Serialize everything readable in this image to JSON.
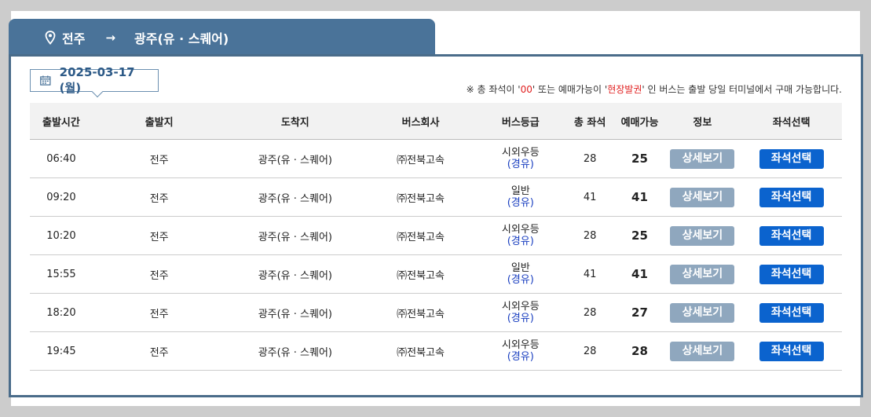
{
  "route": {
    "from": "전주",
    "to": "광주(유 · 스퀘어)",
    "arrow": "→"
  },
  "date": "2025-03-17 (월)",
  "notice": {
    "prefix": "※ 총 좌석이 '",
    "code": "00",
    "middle": "' 또는 예매가능이 '",
    "onsite": "현장발권",
    "suffix": "' 인 버스는 출발 당일 터미널에서 구매 가능합니다."
  },
  "headers": [
    "출발시간",
    "출발지",
    "도착지",
    "버스회사",
    "버스등급",
    "총 좌석",
    "예매가능",
    "정보",
    "좌석선택"
  ],
  "rows": [
    {
      "time": "06:40",
      "from": "전주",
      "to": "광주(유 · 스퀘어)",
      "company": "㈜전북고속",
      "grade": "시외우등",
      "via": "(경유)",
      "total": "28",
      "avail": "25",
      "detail": "상세보기",
      "seat": "좌석선택"
    },
    {
      "time": "09:20",
      "from": "전주",
      "to": "광주(유 · 스퀘어)",
      "company": "㈜전북고속",
      "grade": "일반",
      "via": "(경유)",
      "total": "41",
      "avail": "41",
      "detail": "상세보기",
      "seat": "좌석선택"
    },
    {
      "time": "10:20",
      "from": "전주",
      "to": "광주(유 · 스퀘어)",
      "company": "㈜전북고속",
      "grade": "시외우등",
      "via": "(경유)",
      "total": "28",
      "avail": "25",
      "detail": "상세보기",
      "seat": "좌석선택"
    },
    {
      "time": "15:55",
      "from": "전주",
      "to": "광주(유 · 스퀘어)",
      "company": "㈜전북고속",
      "grade": "일반",
      "via": "(경유)",
      "total": "41",
      "avail": "41",
      "detail": "상세보기",
      "seat": "좌석선택"
    },
    {
      "time": "18:20",
      "from": "전주",
      "to": "광주(유 · 스퀘어)",
      "company": "㈜전북고속",
      "grade": "시외우등",
      "via": "(경유)",
      "total": "28",
      "avail": "27",
      "detail": "상세보기",
      "seat": "좌석선택"
    },
    {
      "time": "19:45",
      "from": "전주",
      "to": "광주(유 · 스퀘어)",
      "company": "㈜전북고속",
      "grade": "시외우등",
      "via": "(경유)",
      "total": "28",
      "avail": "28",
      "detail": "상세보기",
      "seat": "좌석선택"
    }
  ],
  "icons": {
    "route": "location-pin-icon",
    "date": "calendar-icon"
  },
  "colors": {
    "tab": "#4a7399",
    "panel_border": "#4a6c8a",
    "detail_button": "#8fa7be",
    "seat_button": "#0b63ce",
    "via_text": "#1a3fc0",
    "notice_red": "#e01e1e"
  }
}
